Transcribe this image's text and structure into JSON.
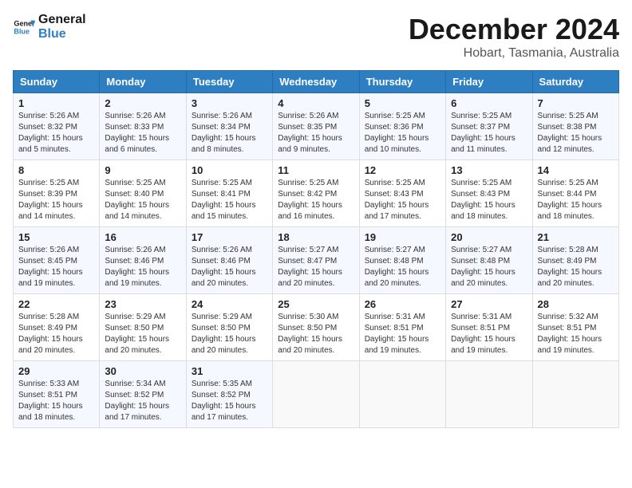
{
  "header": {
    "logo_general": "General",
    "logo_blue": "Blue",
    "title": "December 2024",
    "subtitle": "Hobart, Tasmania, Australia"
  },
  "calendar": {
    "days_of_week": [
      "Sunday",
      "Monday",
      "Tuesday",
      "Wednesday",
      "Thursday",
      "Friday",
      "Saturday"
    ],
    "weeks": [
      [
        {
          "day": "1",
          "sunrise": "5:26 AM",
          "sunset": "8:32 PM",
          "daylight": "15 hours and 5 minutes."
        },
        {
          "day": "2",
          "sunrise": "5:26 AM",
          "sunset": "8:33 PM",
          "daylight": "15 hours and 6 minutes."
        },
        {
          "day": "3",
          "sunrise": "5:26 AM",
          "sunset": "8:34 PM",
          "daylight": "15 hours and 8 minutes."
        },
        {
          "day": "4",
          "sunrise": "5:26 AM",
          "sunset": "8:35 PM",
          "daylight": "15 hours and 9 minutes."
        },
        {
          "day": "5",
          "sunrise": "5:25 AM",
          "sunset": "8:36 PM",
          "daylight": "15 hours and 10 minutes."
        },
        {
          "day": "6",
          "sunrise": "5:25 AM",
          "sunset": "8:37 PM",
          "daylight": "15 hours and 11 minutes."
        },
        {
          "day": "7",
          "sunrise": "5:25 AM",
          "sunset": "8:38 PM",
          "daylight": "15 hours and 12 minutes."
        }
      ],
      [
        {
          "day": "8",
          "sunrise": "5:25 AM",
          "sunset": "8:39 PM",
          "daylight": "15 hours and 14 minutes."
        },
        {
          "day": "9",
          "sunrise": "5:25 AM",
          "sunset": "8:40 PM",
          "daylight": "15 hours and 14 minutes."
        },
        {
          "day": "10",
          "sunrise": "5:25 AM",
          "sunset": "8:41 PM",
          "daylight": "15 hours and 15 minutes."
        },
        {
          "day": "11",
          "sunrise": "5:25 AM",
          "sunset": "8:42 PM",
          "daylight": "15 hours and 16 minutes."
        },
        {
          "day": "12",
          "sunrise": "5:25 AM",
          "sunset": "8:43 PM",
          "daylight": "15 hours and 17 minutes."
        },
        {
          "day": "13",
          "sunrise": "5:25 AM",
          "sunset": "8:43 PM",
          "daylight": "15 hours and 18 minutes."
        },
        {
          "day": "14",
          "sunrise": "5:25 AM",
          "sunset": "8:44 PM",
          "daylight": "15 hours and 18 minutes."
        }
      ],
      [
        {
          "day": "15",
          "sunrise": "5:26 AM",
          "sunset": "8:45 PM",
          "daylight": "15 hours and 19 minutes."
        },
        {
          "day": "16",
          "sunrise": "5:26 AM",
          "sunset": "8:46 PM",
          "daylight": "15 hours and 19 minutes."
        },
        {
          "day": "17",
          "sunrise": "5:26 AM",
          "sunset": "8:46 PM",
          "daylight": "15 hours and 20 minutes."
        },
        {
          "day": "18",
          "sunrise": "5:27 AM",
          "sunset": "8:47 PM",
          "daylight": "15 hours and 20 minutes."
        },
        {
          "day": "19",
          "sunrise": "5:27 AM",
          "sunset": "8:48 PM",
          "daylight": "15 hours and 20 minutes."
        },
        {
          "day": "20",
          "sunrise": "5:27 AM",
          "sunset": "8:48 PM",
          "daylight": "15 hours and 20 minutes."
        },
        {
          "day": "21",
          "sunrise": "5:28 AM",
          "sunset": "8:49 PM",
          "daylight": "15 hours and 20 minutes."
        }
      ],
      [
        {
          "day": "22",
          "sunrise": "5:28 AM",
          "sunset": "8:49 PM",
          "daylight": "15 hours and 20 minutes."
        },
        {
          "day": "23",
          "sunrise": "5:29 AM",
          "sunset": "8:50 PM",
          "daylight": "15 hours and 20 minutes."
        },
        {
          "day": "24",
          "sunrise": "5:29 AM",
          "sunset": "8:50 PM",
          "daylight": "15 hours and 20 minutes."
        },
        {
          "day": "25",
          "sunrise": "5:30 AM",
          "sunset": "8:50 PM",
          "daylight": "15 hours and 20 minutes."
        },
        {
          "day": "26",
          "sunrise": "5:31 AM",
          "sunset": "8:51 PM",
          "daylight": "15 hours and 19 minutes."
        },
        {
          "day": "27",
          "sunrise": "5:31 AM",
          "sunset": "8:51 PM",
          "daylight": "15 hours and 19 minutes."
        },
        {
          "day": "28",
          "sunrise": "5:32 AM",
          "sunset": "8:51 PM",
          "daylight": "15 hours and 19 minutes."
        }
      ],
      [
        {
          "day": "29",
          "sunrise": "5:33 AM",
          "sunset": "8:51 PM",
          "daylight": "15 hours and 18 minutes."
        },
        {
          "day": "30",
          "sunrise": "5:34 AM",
          "sunset": "8:52 PM",
          "daylight": "15 hours and 17 minutes."
        },
        {
          "day": "31",
          "sunrise": "5:35 AM",
          "sunset": "8:52 PM",
          "daylight": "15 hours and 17 minutes."
        },
        null,
        null,
        null,
        null
      ]
    ]
  }
}
